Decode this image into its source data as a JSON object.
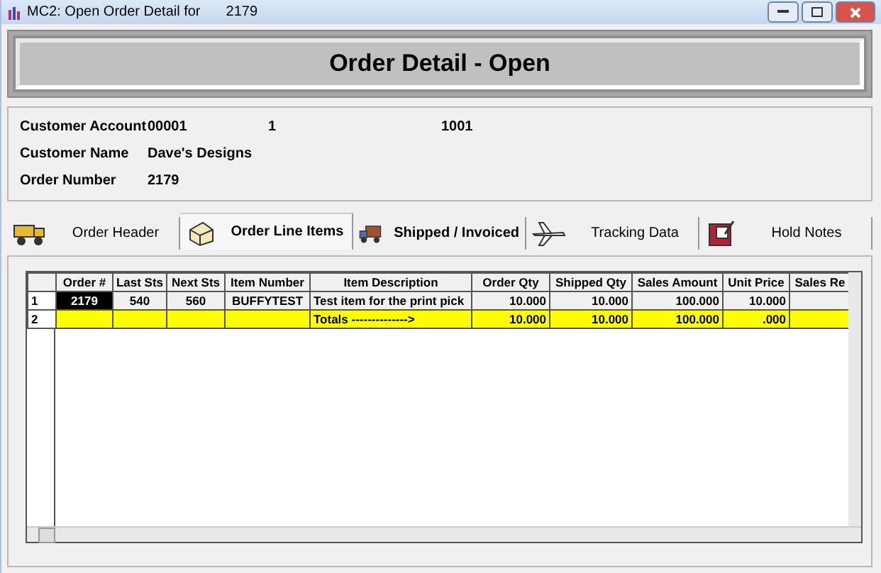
{
  "window": {
    "title": "MC2: Open Order Detail for",
    "title_number": "2179"
  },
  "banner": "Order Detail - Open",
  "customer": [
    {
      "label": "Customer Account",
      "values": [
        "00001",
        "1",
        "1001"
      ]
    },
    {
      "label": "Customer Name",
      "values": [
        "Dave's Designs"
      ]
    },
    {
      "label": "Order Number",
      "values": [
        "2179"
      ]
    }
  ],
  "tabs": [
    {
      "label": "Order Header",
      "selected": false,
      "bold": false
    },
    {
      "label": "Order Line Items",
      "selected": true,
      "bold": true
    },
    {
      "label": "Shipped / Invoiced",
      "selected": false,
      "bold": true
    },
    {
      "label": "Tracking Data",
      "selected": false,
      "bold": false
    },
    {
      "label": "Hold Notes",
      "selected": false,
      "bold": false
    }
  ],
  "table": {
    "columns": [
      "Order #",
      "Last Sts",
      "Next Sts",
      "Item Number",
      "Item Description",
      "Order Qty",
      "Shipped Qty",
      "Sales Amount",
      "Unit Price",
      "Sales Re"
    ],
    "rows": [
      {
        "kind": "line",
        "number": "1",
        "cells": [
          {
            "text": "2179",
            "selected": true
          },
          {
            "text": "540",
            "selected": false
          },
          {
            "text": "560",
            "selected": false
          },
          {
            "text": "BUFFYTEST",
            "selected": false
          },
          {
            "text": "Test item for the print pick",
            "selected": false
          },
          {
            "text": "10.000",
            "selected": false
          },
          {
            "text": "10.000",
            "selected": false
          },
          {
            "text": "100.000",
            "selected": false
          },
          {
            "text": "10.000",
            "selected": false
          },
          {
            "text": "",
            "selected": false
          }
        ]
      },
      {
        "kind": "totals",
        "number": "2",
        "cells": [
          {
            "text": "",
            "selected": false
          },
          {
            "text": "",
            "selected": false
          },
          {
            "text": "",
            "selected": false
          },
          {
            "text": "",
            "selected": false
          },
          {
            "text": "Totals -------------->",
            "selected": false
          },
          {
            "text": "10.000",
            "selected": false
          },
          {
            "text": "10.000",
            "selected": false
          },
          {
            "text": "100.000",
            "selected": false
          },
          {
            "text": ".000",
            "selected": false
          },
          {
            "text": "",
            "selected": false
          }
        ]
      }
    ]
  }
}
